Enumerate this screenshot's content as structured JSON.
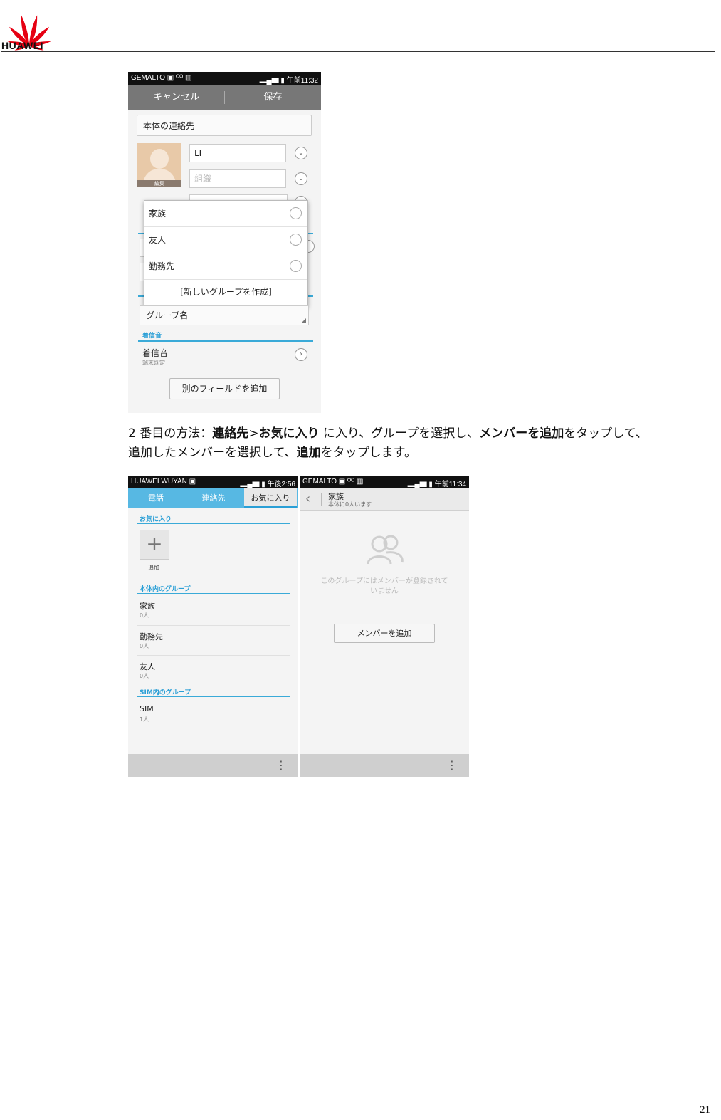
{
  "header": {
    "logo_text": "HUAWEI"
  },
  "shot1": {
    "status_left": "GEMALTO ▣ ᴼᴼ ▥",
    "status_right": "▂▄▆ ▮ 午前11:32",
    "cancel": "キャンセル",
    "save": "保存",
    "account": "本体の連絡先",
    "photo_edit": "編集",
    "name_value": "LI",
    "org_placeholder": "組織",
    "options": [
      "家族",
      "友人",
      "勤務先"
    ],
    "new_group": "[新しいグループを作成]",
    "group_field": "グループ名",
    "ringtone_section": "着信音",
    "ringtone_title": "着信音",
    "ringtone_sub": "端末既定",
    "add_field": "別のフィールドを追加"
  },
  "caption": {
    "p1": "2 番目の方法：",
    "b1": "連絡先",
    "p2": ">",
    "b2": "お気に入り",
    "p3": " に入り、グループを選択し、",
    "b3": "メンバーを追加",
    "p4": "をタップして、",
    "p5": "追加したメンバーを選択して、",
    "b4": "追加",
    "p6": "をタップします。"
  },
  "shot2": {
    "status_left": "HUAWEI WUYAN ▣",
    "status_right": "▂▄▆ ▮ 午後2:56",
    "tabs": [
      "電話",
      "連絡先",
      "お気に入り"
    ],
    "favorites_section": "お気に入り",
    "add_label": "追加",
    "device_groups_section": "本体内のグループ",
    "groups": [
      {
        "name": "家族",
        "count": "0人"
      },
      {
        "name": "勤務先",
        "count": "0人"
      },
      {
        "name": "友人",
        "count": "0人"
      }
    ],
    "sim_section": "SIM内のグループ",
    "sim_group": {
      "name": "SIM",
      "count": "1人"
    },
    "menu": "⋮"
  },
  "shot3": {
    "status_left": "GEMALTO ▣ ᴼᴼ ▥",
    "status_right": "▂▄▆ ▮ 午前11:34",
    "back": "‹",
    "title": "家族",
    "subtitle": "本体に0人います",
    "empty_line1": "このグループにはメンバーが登録されて",
    "empty_line2": "いません",
    "add_member": "メンバーを追加",
    "menu": "⋮"
  },
  "page_number": "21",
  "colors": {
    "logo_red": "#e60012",
    "tab_blue": "#57b8e3",
    "accent_blue": "#2a9fd6"
  }
}
